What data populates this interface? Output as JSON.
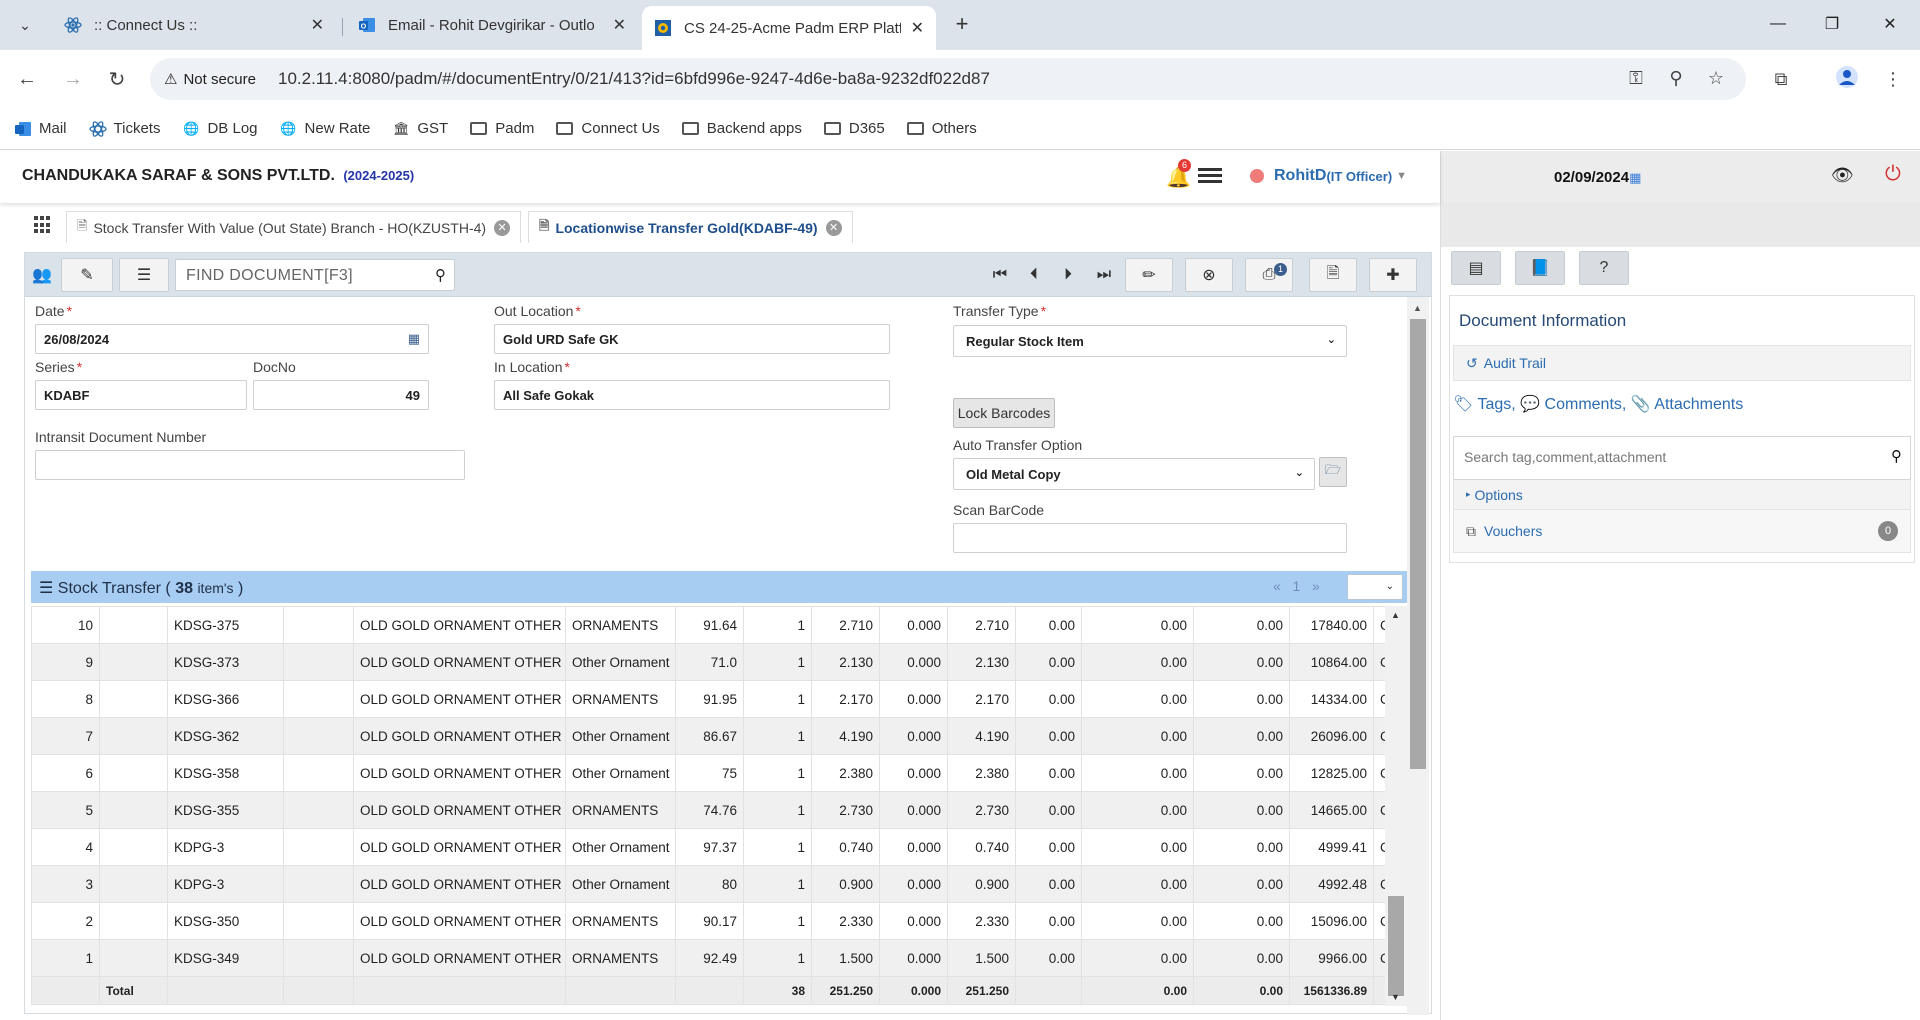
{
  "browser": {
    "tabs": [
      {
        "title": ":: Connect Us ::",
        "icon": "react-icon"
      },
      {
        "title": "Email - Rohit Devgirikar - Outlo",
        "icon": "outlook-icon"
      },
      {
        "title": "CS 24-25-Acme Padm ERP Platf",
        "icon": "erp-icon"
      }
    ],
    "not_secure": "Not secure",
    "url": "10.2.11.4:8080/padm/#/documentEntry/0/21/413?id=6bfd996e-9247-4d6e-ba8a-9232df022d87",
    "bookmarks": [
      {
        "label": "Mail",
        "type": "outlook"
      },
      {
        "label": "Tickets",
        "type": "react"
      },
      {
        "label": "DB Log",
        "type": "globe"
      },
      {
        "label": "New Rate",
        "type": "globe"
      },
      {
        "label": "GST",
        "type": "gst"
      },
      {
        "label": "Padm",
        "type": "folder"
      },
      {
        "label": "Connect Us",
        "type": "folder"
      },
      {
        "label": "Backend apps",
        "type": "folder"
      },
      {
        "label": "D365",
        "type": "folder"
      },
      {
        "label": "Others",
        "type": "folder"
      }
    ]
  },
  "app": {
    "company": "CHANDUKAKA SARAF & SONS PVT.LTD.",
    "year": "(2024-2025)",
    "notif_count": "6",
    "user": "RohitD",
    "role": "(IT Officer)"
  },
  "doc_tabs": [
    {
      "label": "Stock Transfer With Value (Out State) Branch - HO(KZUSTH-4)"
    },
    {
      "label": "Locationwise Transfer Gold(KDABF-49)"
    }
  ],
  "actionbar": {
    "find_placeholder": "FIND DOCUMENT[F3]",
    "print_badge": "1"
  },
  "form": {
    "date_label": "Date",
    "date_value": "26/08/2024",
    "series_label": "Series",
    "series_value": "KDABF",
    "docno_label": "DocNo",
    "docno_value": "49",
    "intransit_label": "Intransit Document Number",
    "intransit_value": "",
    "out_location_label": "Out Location",
    "out_location_value": "Gold URD Safe GK",
    "in_location_label": "In Location",
    "in_location_value": "All Safe Gokak",
    "transfer_type_label": "Transfer Type",
    "transfer_type_value": "Regular Stock Item",
    "lock_barcodes": "Lock Barcodes",
    "auto_transfer_label": "Auto Transfer Option",
    "auto_transfer_value": "Old Metal Copy",
    "scan_barcode_label": "Scan BarCode",
    "scan_barcode_value": ""
  },
  "grid": {
    "title": "Stock Transfer",
    "count": "38",
    "items_word": "item's",
    "page": "1",
    "rows": [
      [
        "10",
        "",
        "KDSG-375",
        "",
        "OLD GOLD ORNAMENT OTHER",
        "ORNAMENTS",
        "91.64",
        "1",
        "2.710",
        "0.000",
        "2.710",
        "0.00",
        "0.00",
        "0.00",
        "17840.00",
        "C"
      ],
      [
        "9",
        "",
        "KDSG-373",
        "",
        "OLD GOLD ORNAMENT OTHER",
        "Other Ornament",
        "71.0",
        "1",
        "2.130",
        "0.000",
        "2.130",
        "0.00",
        "0.00",
        "0.00",
        "10864.00",
        "C"
      ],
      [
        "8",
        "",
        "KDSG-366",
        "",
        "OLD GOLD ORNAMENT OTHER",
        "ORNAMENTS",
        "91.95",
        "1",
        "2.170",
        "0.000",
        "2.170",
        "0.00",
        "0.00",
        "0.00",
        "14334.00",
        "C"
      ],
      [
        "7",
        "",
        "KDSG-362",
        "",
        "OLD GOLD ORNAMENT OTHER",
        "Other Ornament",
        "86.67",
        "1",
        "4.190",
        "0.000",
        "4.190",
        "0.00",
        "0.00",
        "0.00",
        "26096.00",
        "C"
      ],
      [
        "6",
        "",
        "KDSG-358",
        "",
        "OLD GOLD ORNAMENT OTHER",
        "Other Ornament",
        "75",
        "1",
        "2.380",
        "0.000",
        "2.380",
        "0.00",
        "0.00",
        "0.00",
        "12825.00",
        "C"
      ],
      [
        "5",
        "",
        "KDSG-355",
        "",
        "OLD GOLD ORNAMENT OTHER",
        "ORNAMENTS",
        "74.76",
        "1",
        "2.730",
        "0.000",
        "2.730",
        "0.00",
        "0.00",
        "0.00",
        "14665.00",
        "C"
      ],
      [
        "4",
        "",
        "KDPG-3",
        "",
        "OLD GOLD ORNAMENT OTHER",
        "Other Ornament",
        "97.37",
        "1",
        "0.740",
        "0.000",
        "0.740",
        "0.00",
        "0.00",
        "0.00",
        "4999.41",
        "C"
      ],
      [
        "3",
        "",
        "KDPG-3",
        "",
        "OLD GOLD ORNAMENT OTHER",
        "Other Ornament",
        "80",
        "1",
        "0.900",
        "0.000",
        "0.900",
        "0.00",
        "0.00",
        "0.00",
        "4992.48",
        "C"
      ],
      [
        "2",
        "",
        "KDSG-350",
        "",
        "OLD GOLD ORNAMENT OTHER",
        "ORNAMENTS",
        "90.17",
        "1",
        "2.330",
        "0.000",
        "2.330",
        "0.00",
        "0.00",
        "0.00",
        "15096.00",
        "C"
      ],
      [
        "1",
        "",
        "KDSG-349",
        "",
        "OLD GOLD ORNAMENT OTHER",
        "ORNAMENTS",
        "92.49",
        "1",
        "1.500",
        "0.000",
        "1.500",
        "0.00",
        "0.00",
        "0.00",
        "9966.00",
        "C"
      ]
    ],
    "total": [
      "",
      "Total",
      "",
      "",
      "",
      "",
      "",
      "38",
      "251.250",
      "0.000",
      "251.250",
      "",
      "0.00",
      "0.00",
      "1561336.89",
      ""
    ]
  },
  "right_panel": {
    "date": "02/09/2024",
    "doc_info_title": "Document Information",
    "audit_trail": "Audit Trail",
    "tags": "Tags,",
    "comments": "Comments,",
    "attachments": "Attachments",
    "search_placeholder": "Search tag,comment,attachment",
    "options": "Options",
    "vouchers": "Vouchers",
    "vouchers_count": "0"
  }
}
